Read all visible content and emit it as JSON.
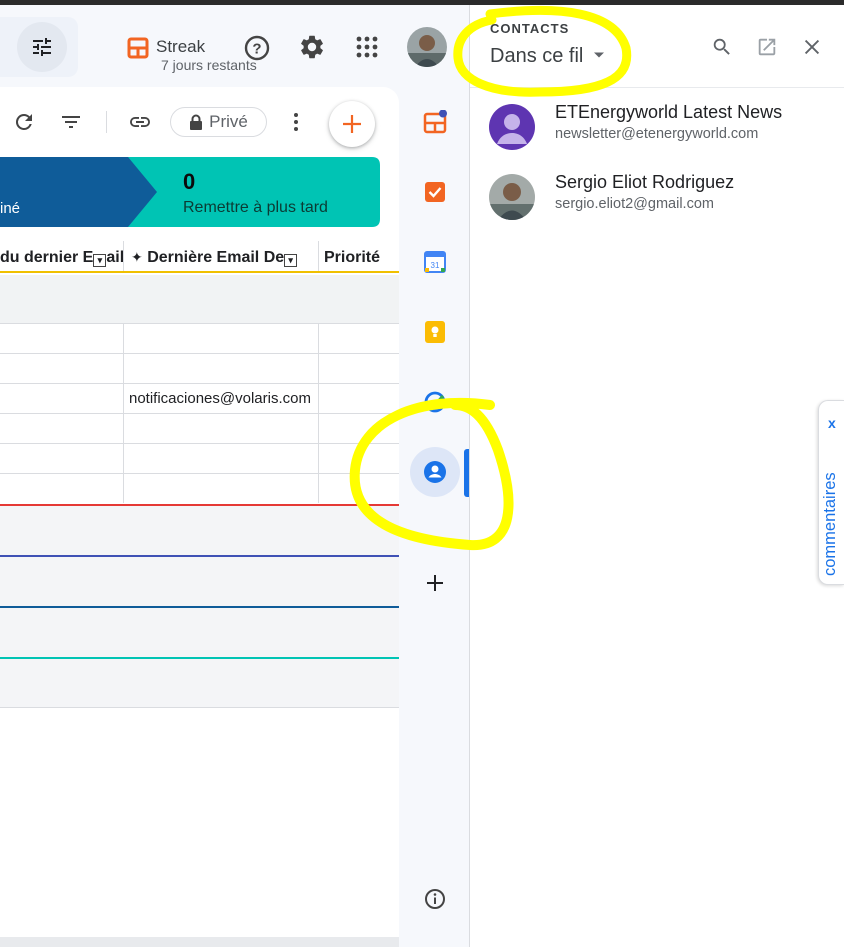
{
  "header": {
    "streak_name": "Streak",
    "streak_subtitle": "7 jours restants"
  },
  "toolbar": {
    "private_label": "Privé"
  },
  "banner": {
    "left_partial_label": "iné",
    "count": "0",
    "right_label": "Remettre à plus tard",
    "left_color": "#0f5c99",
    "right_color": "#00c4b4"
  },
  "table": {
    "columns": [
      "du dernier E",
      "ail",
      "Dernière Email De",
      "Priorité"
    ],
    "visible_cell_email": "notificaciones@volaris.com"
  },
  "contacts_panel": {
    "title": "CONTACTS",
    "filter": "Dans ce fil",
    "contacts": [
      {
        "name": "ETEnergyworld Latest News",
        "email": "newsletter@etenergyworld.com"
      },
      {
        "name": "Sergio Eliot Rodriguez",
        "email": "sergio.eliot2@gmail.com"
      }
    ]
  },
  "side_tab": {
    "label": "commentaires",
    "close": "x"
  },
  "colors": {
    "highlight": "#ffff00",
    "accent": "#1a73e8",
    "streak_orange": "#f26522"
  }
}
